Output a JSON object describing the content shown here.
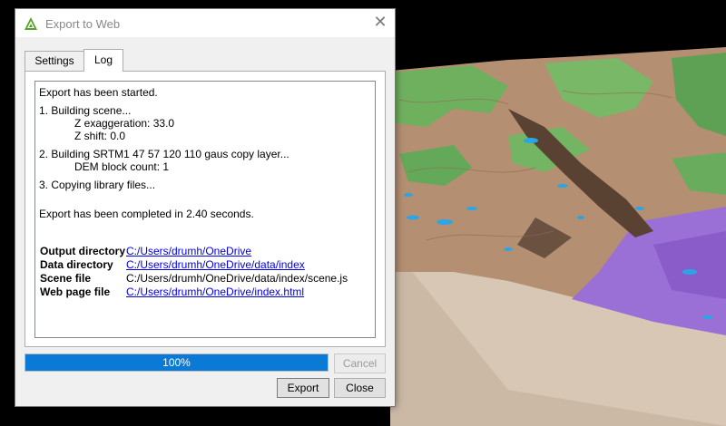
{
  "window": {
    "title": "Export to Web",
    "close_icon": "close-icon",
    "app_icon": "qgis-icon"
  },
  "tabs": [
    {
      "label": "Settings",
      "active": false
    },
    {
      "label": "Log",
      "active": true
    }
  ],
  "log": {
    "started": "Export has been started.",
    "step1": "1. Building scene...",
    "z_exag": "Z exaggeration: 33.0",
    "z_shift": "Z shift: 0.0",
    "step2": "2. Building SRTM1 47 57 120 110 gaus copy layer...",
    "dem_block": "DEM block count: 1",
    "step3": "3. Copying library files...",
    "completed": "Export has been completed in 2.40 seconds.",
    "results": [
      {
        "label": "Output directory",
        "value": "C:/Users/drumh/OneDrive",
        "is_link": true
      },
      {
        "label": "Data directory",
        "value": "C:/Users/drumh/OneDrive/data/index",
        "is_link": true
      },
      {
        "label": "Scene file",
        "value": "C:/Users/drumh/OneDrive/data/index/scene.js",
        "is_link": false
      },
      {
        "label": "Web page file",
        "value": "C:/Users/drumh/OneDrive/index.html",
        "is_link": true
      }
    ]
  },
  "progress": {
    "value": 1.0,
    "label": "100%",
    "color": "#0a7ad6"
  },
  "buttons": {
    "cancel": "Cancel",
    "export": "Export",
    "close": "Close"
  },
  "colors": {
    "link": "#0000ee",
    "terrain_soil": "#b8967a",
    "terrain_green": "#6fae5a",
    "terrain_purple": "#9b70d8",
    "water": "#29a8e8",
    "base": "#d9c9b8"
  }
}
